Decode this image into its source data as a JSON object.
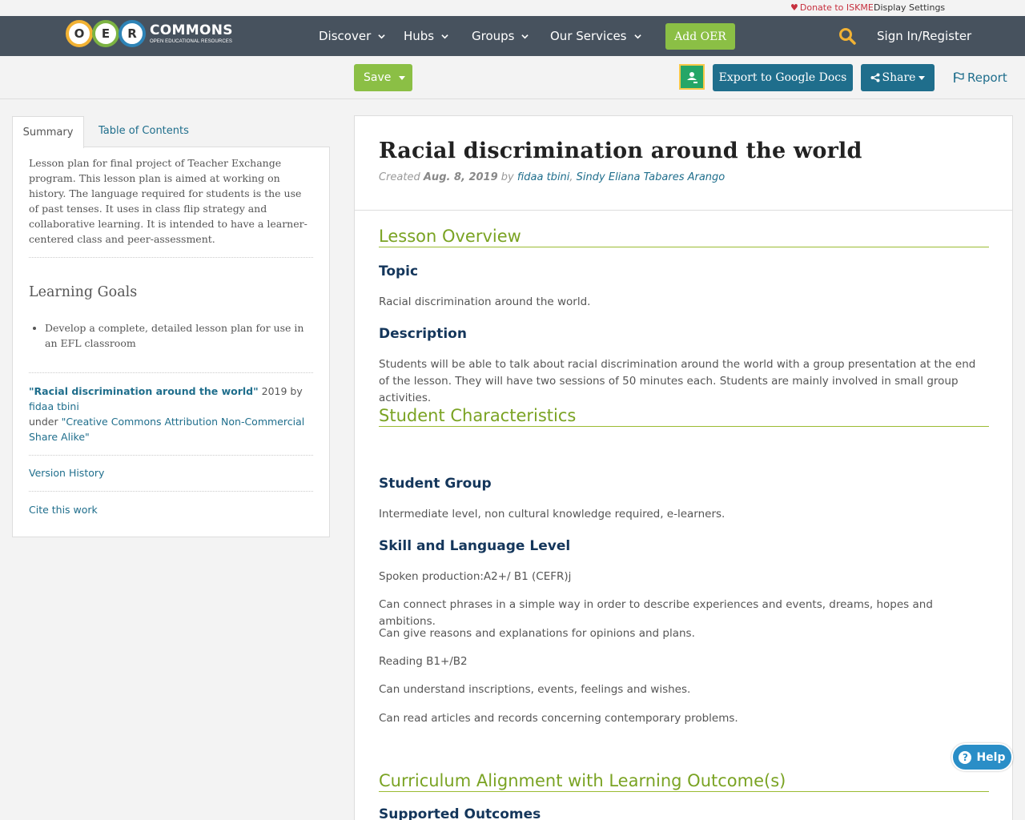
{
  "topstrip": {
    "donate": "Donate to ISKME",
    "display_settings": "Display Settings"
  },
  "nav": {
    "logo_letters": [
      "O",
      "E",
      "R"
    ],
    "logo_main": "COMMONS",
    "logo_sub": "OPEN EDUCATIONAL RESOURCES",
    "items": [
      "Discover",
      "Hubs",
      "Groups",
      "Our Services"
    ],
    "add_oer": "Add OER",
    "sign_in": "Sign In/Register"
  },
  "toolbar": {
    "save": "Save",
    "export": "Export to Google Docs",
    "share": "Share",
    "report": "Report"
  },
  "sidebar": {
    "tabs": [
      "Summary",
      "Table of Contents"
    ],
    "summary": "Lesson plan for final project of Teacher Exchange program. This lesson plan is aimed at working on history. The language required for students is the use of past tenses. It uses in class flip strategy and collaborative learning. It is intended to have a learner-centered class and peer-assessment.",
    "goals_title": "Learning Goals",
    "goals": [
      "Develop a complete, detailed lesson plan for use in an EFL classroom"
    ],
    "license": {
      "work_title": "\"Racial discrimination around the world\"",
      "year_by": " 2019 by ",
      "author": "fidaa tbini",
      "under": "under ",
      "license_name": "\"Creative Commons Attribution Non-Commercial Share Alike\""
    },
    "version_history": "Version History",
    "cite": "Cite this work"
  },
  "main": {
    "title": "Racial discrimination around the world",
    "created_label": "Created ",
    "created_date": "Aug. 8, 2019",
    "by_label": " by ",
    "author1": "fidaa tbini",
    "comma": ", ",
    "author2": "Sindy Eliana Tabares Arango",
    "lesson_overview": "Lesson Overview",
    "topic_heading": "Topic",
    "topic_text": "Racial discrimination around the world.",
    "description_heading": "Description",
    "description_text": "Students will be able to talk about racial discrimination around the world with a group presentation at the end of the lesson. They  will have two sessions of 50 minutes each. Students are mainly involved in small group activities.",
    "student_characteristics": "Student Characteristics",
    "student_group_heading": "Student Group",
    "student_group_text": "Intermediate level, non cultural knowledge required, e-learners.",
    "skill_heading": "Skill and Language Level",
    "skill_lines": [
      "Spoken production:A2+/ B1 (CEFR)j",
      "Can connect phrases in a simple way in order to describe experiences and events, dreams, hopes and ambitions.",
      "Can give reasons and explanations for opinions and plans.",
      "Reading B1+/B2",
      "Can understand inscriptions, events, feelings and wishes.",
      "Can read articles and records concerning contemporary problems."
    ],
    "curriculum": "Curriculum Alignment with Learning Outcome(s)",
    "supported_outcomes": "Supported Outcomes"
  },
  "help": "Help",
  "colors": {
    "nav_bg": "#47525e",
    "accent_green": "#8bbf45",
    "accent_blue": "#1f6e8c",
    "heading_green": "#7aa323",
    "heading_navy": "#14365b"
  }
}
